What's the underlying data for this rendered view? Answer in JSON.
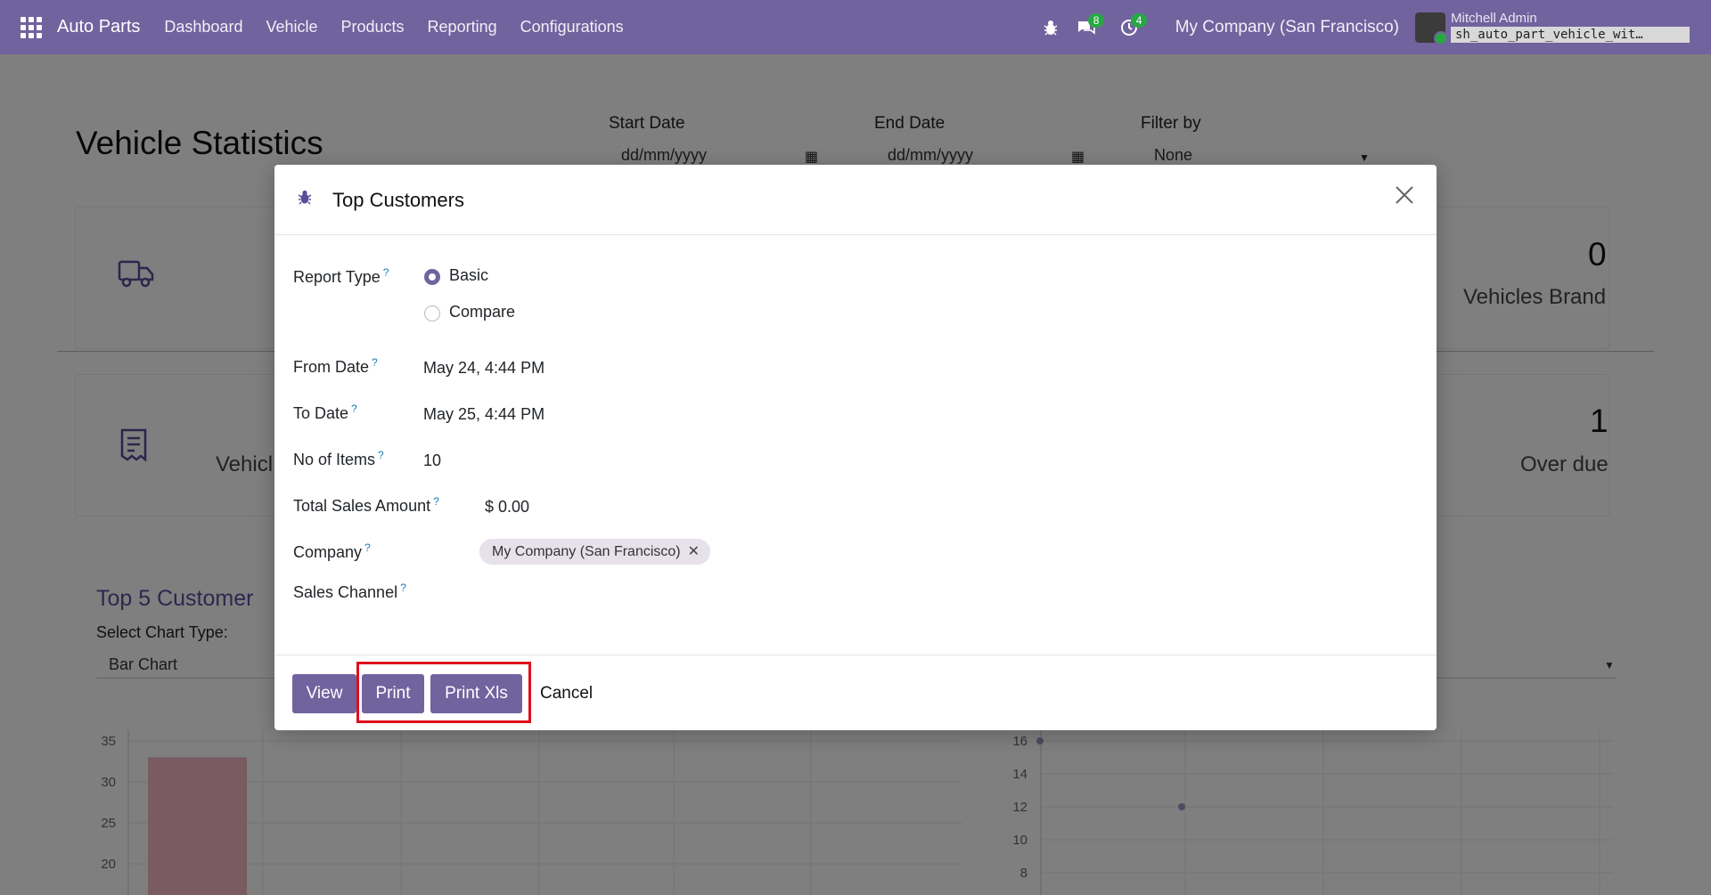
{
  "navbar": {
    "app_name": "Auto Parts",
    "menu": [
      "Dashboard",
      "Vehicle",
      "Products",
      "Reporting",
      "Configurations"
    ],
    "messages_count": "8",
    "activities_count": "4",
    "company": "My Company (San Francisco)",
    "user_name": "Mitchell Admin",
    "database": "sh_auto_part_vehicle_wit…"
  },
  "page": {
    "title": "Vehicle Statistics",
    "filters": {
      "start_label": "Start Date",
      "start_placeholder": "dd/mm/yyyy",
      "end_label": "End Date",
      "end_placeholder": "dd/mm/yyyy",
      "filter_label": "Filter by",
      "filter_value": "None"
    },
    "cards": [
      {
        "value": "0",
        "label": "Vehicles Brand",
        "icon": "truck-icon"
      },
      {
        "value": "1",
        "label": "Over due",
        "icon": "receipt-icon",
        "left_label": "Vehicl"
      }
    ],
    "chart_section": {
      "title": "Top 5 Customer",
      "select_label": "Select Chart Type:",
      "select_value": "Bar Chart"
    }
  },
  "chart_data": [
    {
      "type": "bar",
      "yticks": [
        35,
        30,
        25,
        20
      ],
      "ylim": [
        20,
        35
      ],
      "series": [
        {
          "values": [
            33
          ]
        }
      ],
      "colors": [
        "#f2b6c3"
      ]
    },
    {
      "type": "scatter",
      "yticks": [
        16,
        14,
        12,
        10,
        8
      ],
      "ylim": [
        8,
        16
      ],
      "points": [
        16,
        12
      ]
    }
  ],
  "modal": {
    "title": "Top Customers",
    "report_type_label": "Report Type",
    "report_type_options": [
      "Basic",
      "Compare"
    ],
    "from_date_label": "From Date",
    "from_date_value": "May 24, 4:44 PM",
    "to_date_label": "To Date",
    "to_date_value": "May 25, 4:44 PM",
    "items_label": "No of Items",
    "items_value": "10",
    "total_label": "Total Sales Amount",
    "total_value": "$ 0.00",
    "company_label": "Company",
    "company_tag": "My Company (San Francisco)",
    "channel_label": "Sales Channel",
    "help_mark": "?",
    "buttons": {
      "view": "View",
      "print": "Print",
      "print_xls": "Print Xls",
      "cancel": "Cancel"
    }
  }
}
